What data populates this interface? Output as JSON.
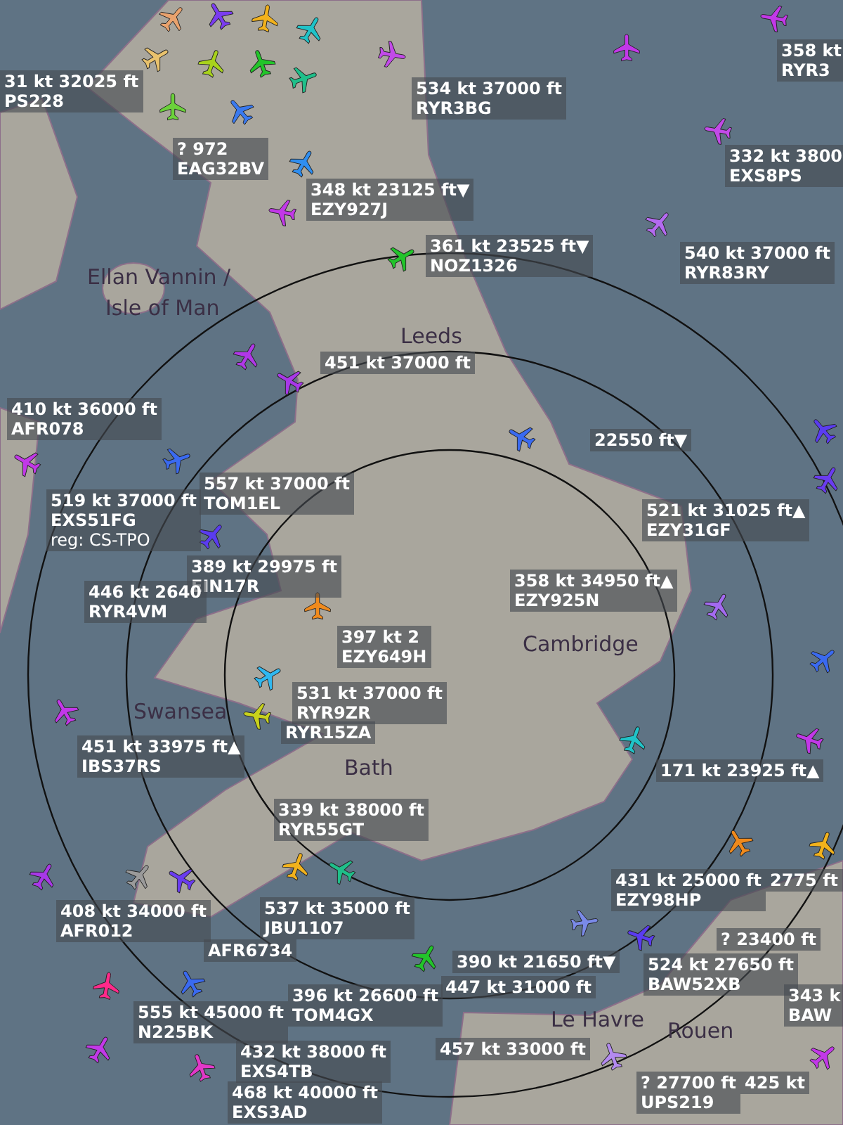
{
  "map_labels": [
    "Ellan Vannin /",
    "Isle of Man",
    "Leeds",
    "Swansea",
    "Bath",
    "Cambridge",
    "Le Havre",
    "Rouen"
  ],
  "flights": [
    {
      "line": "31 kt 32025 ft",
      "callsign": "PS228"
    },
    {
      "line": "534 kt 37000 ft",
      "callsign": "RYR3BG"
    },
    {
      "line": "358 kt",
      "callsign": "RYR3"
    },
    {
      "line": "? 972",
      "callsign": "EAG32BV"
    },
    {
      "line": "332 kt 3800",
      "callsign": "EXS8PS"
    },
    {
      "line": "348 kt 23125 ft▼",
      "callsign": "EZY927J"
    },
    {
      "line": "361 kt 23525 ft▼",
      "callsign": "NOZ1326"
    },
    {
      "line": "540 kt 37000 ft",
      "callsign": "RYR83RY"
    },
    {
      "line": "451 kt 37000 ft"
    },
    {
      "line": "410 kt 36000 ft",
      "callsign": "AFR078"
    },
    {
      "line": "22550 ft▼"
    },
    {
      "line": "519 kt 37000 ft",
      "callsign": "EXS51FG",
      "reg": "reg: CS-TPO"
    },
    {
      "line": "557 kt 37000 ft",
      "callsign": "TOM1EL"
    },
    {
      "line": "521 kt 31025 ft▲",
      "callsign": "EZY31GF"
    },
    {
      "line": "389 kt 29975 ft",
      "callsign": "EIN17R"
    },
    {
      "line": "446 kt 2640",
      "callsign": "RYR4VM"
    },
    {
      "line": "358 kt 34950 ft▲",
      "callsign": "EZY925N"
    },
    {
      "line": "397 kt 2",
      "callsign": "EZY649H"
    },
    {
      "line": "531 kt 37000 ft",
      "callsign": "RYR9ZR"
    },
    {
      "callsign": "RYR15ZA"
    },
    {
      "line": "451 kt 33975 ft▲",
      "callsign": "IBS37RS"
    },
    {
      "line": "171 kt 23925 ft▲"
    },
    {
      "line": "339 kt 38000 ft",
      "callsign": "RYR55GT"
    },
    {
      "line": "431 kt 25000 ft",
      "callsign": "EZY98HP"
    },
    {
      "line": "2775 ft"
    },
    {
      "line": "408 kt 34000 ft",
      "callsign": "AFR012"
    },
    {
      "line": "537 kt 35000 ft",
      "callsign": "JBU1107"
    },
    {
      "callsign": "AFR6734"
    },
    {
      "line": "? 23400 ft"
    },
    {
      "line": "390 kt 21650 ft▼"
    },
    {
      "line": "524 kt 27650 ft",
      "callsign": "BAW52XB"
    },
    {
      "line": "555 kt 45000 ft",
      "callsign": "N225BK"
    },
    {
      "line": "396 kt 26600 ft",
      "callsign": "TOM4GX"
    },
    {
      "line": "447 kt 31000 ft"
    },
    {
      "line": "343 k",
      "callsign": "BAW"
    },
    {
      "line": "432 kt 38000 ft",
      "callsign": "EXS4TB"
    },
    {
      "line": "457 kt 33000 ft"
    },
    {
      "line": "? 27700 ft",
      "callsign": "UPS219"
    },
    {
      "line": "425 kt"
    },
    {
      "line": "468 kt 40000 ft",
      "callsign": "EXS3AD"
    }
  ],
  "planes": [
    {
      "color": "#e9a26d"
    },
    {
      "color": "#7a3cf0"
    },
    {
      "color": "#f2b21c"
    },
    {
      "color": "#e9c26d"
    },
    {
      "color": "#a8d21c"
    },
    {
      "color": "#22c42a"
    },
    {
      "color": "#20c3c8"
    },
    {
      "color": "#3a7af0"
    },
    {
      "color": "#c24ae8"
    },
    {
      "color": "#1fbf8a"
    },
    {
      "color": "#6bd23a"
    },
    {
      "color": "#2f8ef0"
    },
    {
      "color": "#c238e8"
    },
    {
      "color": "#22c42a"
    },
    {
      "color": "#c238e8"
    },
    {
      "color": "#c24ae8"
    },
    {
      "color": "#b36af0"
    },
    {
      "color": "#c238e8"
    },
    {
      "color": "#5a3cf0"
    },
    {
      "color": "#6a3cf0"
    },
    {
      "color": "#c238e8"
    },
    {
      "color": "#5a3cf0"
    },
    {
      "color": "#3a6af0"
    },
    {
      "color": "#f08a1c"
    },
    {
      "color": "#2fb8f0"
    },
    {
      "color": "#c8d21c"
    },
    {
      "color": "#c238e8"
    },
    {
      "color": "#a36af0"
    },
    {
      "color": "#c238e8"
    },
    {
      "color": "#3a6af0"
    },
    {
      "color": "#b038e8"
    },
    {
      "color": "#3a6af0"
    },
    {
      "color": "#a838e8"
    },
    {
      "color": "#f2b21c"
    },
    {
      "color": "#1fbf8a"
    },
    {
      "color": "#9a9a9a"
    },
    {
      "color": "#6a3cf0"
    },
    {
      "color": "#a838e8"
    },
    {
      "color": "#3a6af0"
    },
    {
      "color": "#ff2a8a"
    },
    {
      "color": "#c238e8"
    },
    {
      "color": "#e238c8"
    },
    {
      "color": "#7a8ae8"
    },
    {
      "color": "#b38af0"
    },
    {
      "color": "#c238e8"
    },
    {
      "color": "#f2b21c"
    },
    {
      "color": "#20c3c8"
    },
    {
      "color": "#5a3cf0"
    },
    {
      "color": "#f08a1c"
    },
    {
      "color": "#22c42a"
    }
  ]
}
